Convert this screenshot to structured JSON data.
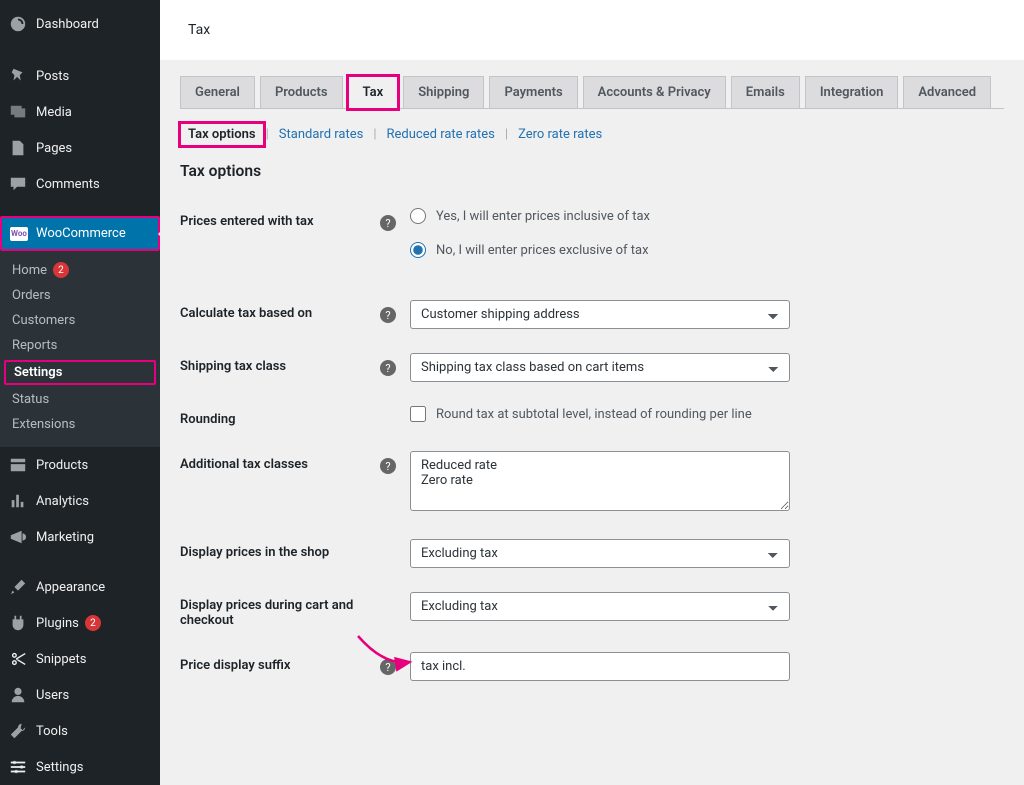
{
  "sidebar": {
    "dashboard": "Dashboard",
    "posts": "Posts",
    "media": "Media",
    "pages": "Pages",
    "comments": "Comments",
    "woocommerce": "WooCommerce",
    "woo_badge": "Woo",
    "sub": {
      "home": "Home",
      "home_badge": "2",
      "orders": "Orders",
      "customers": "Customers",
      "reports": "Reports",
      "settings": "Settings",
      "status": "Status",
      "extensions": "Extensions"
    },
    "products": "Products",
    "analytics": "Analytics",
    "marketing": "Marketing",
    "appearance": "Appearance",
    "plugins": "Plugins",
    "plugins_badge": "2",
    "snippets": "Snippets",
    "users": "Users",
    "tools": "Tools",
    "settings_wp": "Settings"
  },
  "page": {
    "title": "Tax",
    "tabs": {
      "general": "General",
      "products": "Products",
      "tax": "Tax",
      "shipping": "Shipping",
      "payments": "Payments",
      "accounts": "Accounts & Privacy",
      "emails": "Emails",
      "integration": "Integration",
      "advanced": "Advanced"
    },
    "subtabs": {
      "options": "Tax options",
      "standard": "Standard rates",
      "reduced": "Reduced rate rates",
      "zero": "Zero rate rates"
    },
    "section_title": "Tax options"
  },
  "form": {
    "prices_label": "Prices entered with tax",
    "prices_opt1": "Yes, I will enter prices inclusive of tax",
    "prices_opt2": "No, I will enter prices exclusive of tax",
    "calc_label": "Calculate tax based on",
    "calc_value": "Customer shipping address",
    "ship_class_label": "Shipping tax class",
    "ship_class_value": "Shipping tax class based on cart items",
    "rounding_label": "Rounding",
    "rounding_text": "Round tax at subtotal level, instead of rounding per line",
    "additional_label": "Additional tax classes",
    "additional_value": "Reduced rate\nZero rate",
    "shop_display_label": "Display prices in the shop",
    "shop_display_value": "Excluding tax",
    "cart_display_label": "Display prices during cart and checkout",
    "cart_display_value": "Excluding tax",
    "suffix_label": "Price display suffix",
    "suffix_value": "tax incl."
  },
  "help_glyph": "?"
}
